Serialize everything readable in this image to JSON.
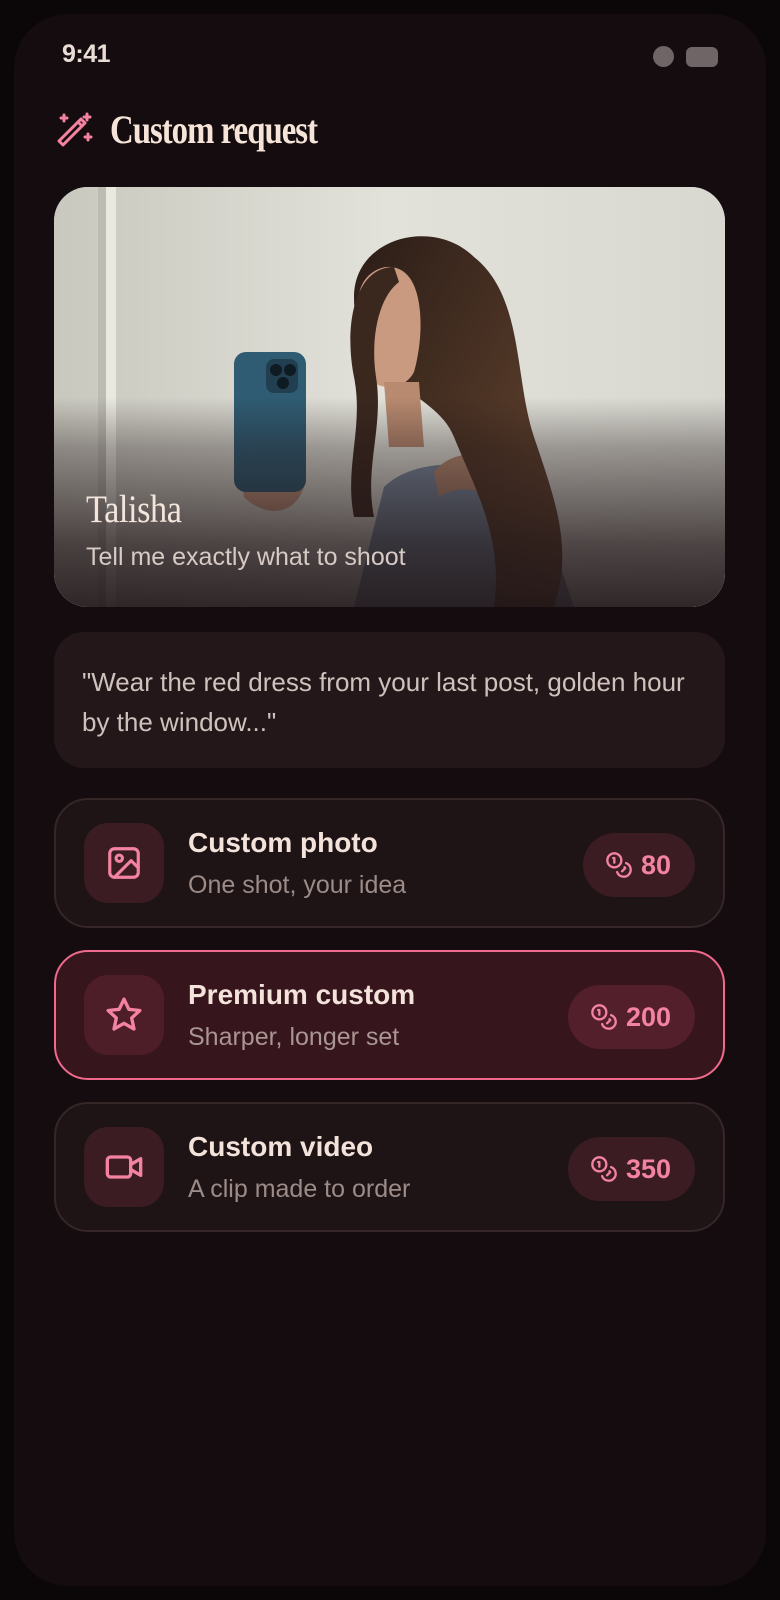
{
  "status": {
    "time": "9:41"
  },
  "header": {
    "title": "Custom request",
    "icon": "magic-wand-icon"
  },
  "hero": {
    "name": "Talisha",
    "subtitle": "Tell me exactly what to shoot"
  },
  "quote": "\"Wear the red dress from your last post, golden hour by the window...\"",
  "options": [
    {
      "icon": "image-icon",
      "title": "Custom photo",
      "subtitle": "One shot, your idea",
      "price": "80",
      "selected": false
    },
    {
      "icon": "star-icon",
      "title": "Premium custom",
      "subtitle": "Sharper, longer set",
      "price": "200",
      "selected": true
    },
    {
      "icon": "video-camera-icon",
      "title": "Custom video",
      "subtitle": "A clip made to order",
      "price": "350",
      "selected": false
    }
  ],
  "colors": {
    "accent": "#ef6a8d",
    "background": "#140c0e",
    "card": "#1e1416",
    "selected_card": "#36151d"
  }
}
